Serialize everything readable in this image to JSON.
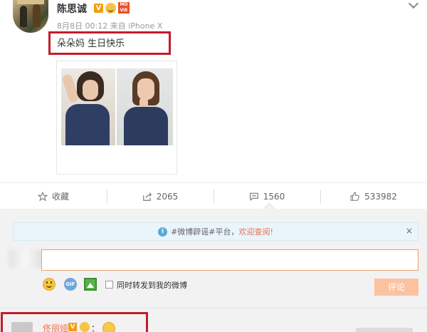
{
  "post": {
    "author": "陈思诚",
    "verified_badge": "V",
    "timestamp": "8月8日 00:12",
    "source_prefix": "来自",
    "source": "iPhone X",
    "text": "朵朵妈 生日快乐",
    "highlight_color": "#c21d2b"
  },
  "actions": {
    "favorite_label": "收藏",
    "repost_count": "2065",
    "comment_count": "1560",
    "like_count": "533982"
  },
  "comment_panel": {
    "notice_text": "#微博辟谣#平台，",
    "notice_link": "欢迎查阅!",
    "notice_close": "×",
    "input_placeholder": "",
    "forward_label": "同时转发到我的微博",
    "submit_label": "评论",
    "gif_label": "GIF"
  },
  "first_comment": {
    "author": "佟丽娅",
    "verified_badge": "V",
    "colon": "："
  },
  "colors": {
    "accent": "#eb7350",
    "submit_disabled": "#fbc2a0",
    "notice_bg": "#eaf4fb"
  }
}
